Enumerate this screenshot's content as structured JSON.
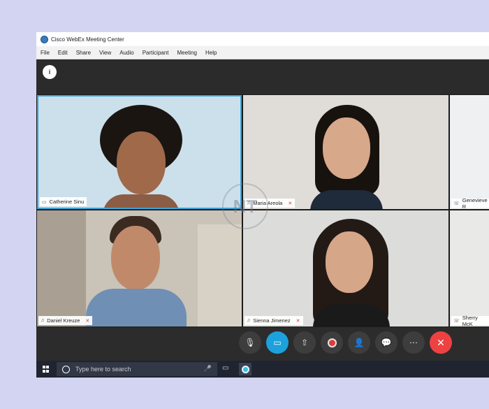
{
  "window": {
    "title": "Cisco WebEx Meeting Center"
  },
  "menu": [
    "File",
    "Edit",
    "Share",
    "View",
    "Audio",
    "Participant",
    "Meeting",
    "Help"
  ],
  "toolbar": {
    "info_glyph": "i"
  },
  "participants": [
    {
      "name": "Catherine Sinu",
      "icon": "monitor-icon",
      "muted": false
    },
    {
      "name": "Maria Areola",
      "icon": "headset-icon",
      "muted": true
    },
    {
      "name": "Genevieve R",
      "icon": "phone-icon",
      "muted": false
    },
    {
      "name": "Daniel Kreuze",
      "icon": "headset-icon",
      "muted": true
    },
    {
      "name": "Sienna Jimenez",
      "icon": "headset-icon",
      "muted": true
    },
    {
      "name": "Sherry McK",
      "icon": "phone-icon",
      "muted": false
    }
  ],
  "controls": [
    {
      "name": "mute-button",
      "icon": "microphone-muted-icon"
    },
    {
      "name": "video-button",
      "icon": "camera-icon"
    },
    {
      "name": "share-button",
      "icon": "upload-icon"
    },
    {
      "name": "record-button",
      "icon": "record-icon"
    },
    {
      "name": "participants-button",
      "icon": "add-person-icon"
    },
    {
      "name": "chat-button",
      "icon": "chat-bubble-icon"
    },
    {
      "name": "more-button",
      "icon": "ellipsis-icon"
    },
    {
      "name": "leave-button",
      "icon": "close-icon"
    }
  ],
  "taskbar": {
    "search_placeholder": "Type here to search"
  },
  "watermark": {
    "text": "NT"
  },
  "colors": {
    "active_border": "#3aa3d9",
    "video_on": "#1ca1dc",
    "leave": "#ee4242",
    "mute_red": "#d13b3b"
  }
}
